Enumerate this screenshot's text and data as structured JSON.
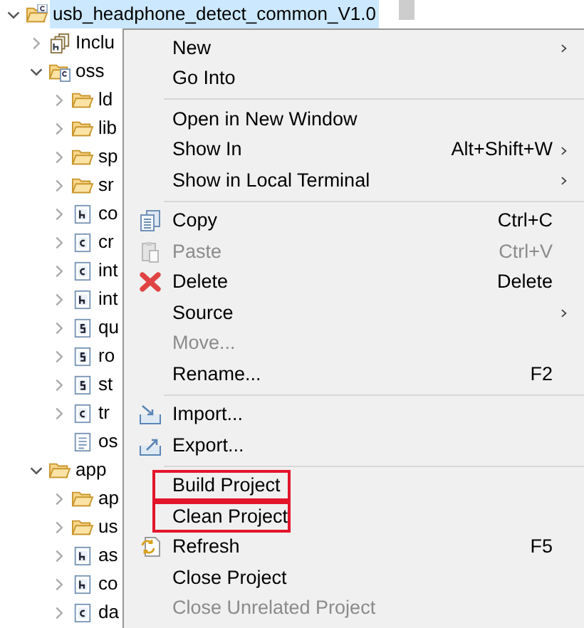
{
  "tree": [
    {
      "label": "usb_headphone_detect_common_V1.0",
      "kind": "project",
      "expanded": true,
      "selected": true,
      "children": [
        {
          "label": "Inclu",
          "kind": "includes",
          "expanded": false,
          "selected": false
        },
        {
          "label": "oss",
          "kind": "source-folder",
          "expanded": true,
          "selected": false,
          "children": [
            {
              "label": "ld",
              "kind": "folder",
              "expanded": false,
              "selected": false
            },
            {
              "label": "lib",
              "kind": "folder",
              "expanded": false,
              "selected": false
            },
            {
              "label": "sp",
              "kind": "folder",
              "expanded": false,
              "selected": false
            },
            {
              "label": "sr",
              "kind": "folder",
              "expanded": false,
              "selected": false
            },
            {
              "label": "co",
              "kind": "h",
              "expanded": false,
              "selected": false
            },
            {
              "label": "cr",
              "kind": "c",
              "expanded": false,
              "selected": false
            },
            {
              "label": "int",
              "kind": "c",
              "expanded": false,
              "selected": false
            },
            {
              "label": "int",
              "kind": "h",
              "expanded": false,
              "selected": false
            },
            {
              "label": "qu",
              "kind": "s",
              "expanded": false,
              "selected": false
            },
            {
              "label": "ro",
              "kind": "s",
              "expanded": false,
              "selected": false
            },
            {
              "label": "st",
              "kind": "s",
              "expanded": false,
              "selected": false
            },
            {
              "label": "tr",
              "kind": "c",
              "expanded": false,
              "selected": false
            },
            {
              "label": "os",
              "kind": "text",
              "selected": false
            }
          ]
        },
        {
          "label": "app",
          "kind": "folder",
          "expanded": true,
          "selected": false,
          "children": [
            {
              "label": "ap",
              "kind": "folder",
              "expanded": false,
              "selected": false
            },
            {
              "label": "us",
              "kind": "folder",
              "expanded": false,
              "selected": false
            },
            {
              "label": "as",
              "kind": "h",
              "expanded": false,
              "selected": false
            },
            {
              "label": "co",
              "kind": "h",
              "expanded": false,
              "selected": false
            },
            {
              "label": "da",
              "kind": "c",
              "expanded": false,
              "selected": false
            }
          ]
        }
      ]
    }
  ],
  "context_menu": [
    {
      "kind": "item",
      "label": "New",
      "submenu": true,
      "disabled": false,
      "highlighted": false
    },
    {
      "kind": "item",
      "label": "Go Into",
      "disabled": false,
      "highlighted": false
    },
    {
      "kind": "separator"
    },
    {
      "kind": "item",
      "label": "Open in New Window",
      "disabled": false,
      "highlighted": false
    },
    {
      "kind": "item",
      "label": "Show In",
      "shortcut": "Alt+Shift+W",
      "submenu": true,
      "disabled": false,
      "highlighted": false
    },
    {
      "kind": "item",
      "label": "Show in Local Terminal",
      "submenu": true,
      "disabled": false,
      "highlighted": false
    },
    {
      "kind": "separator"
    },
    {
      "kind": "copy",
      "label": "Copy",
      "shortcut": "Ctrl+C",
      "disabled": false,
      "highlighted": false
    },
    {
      "kind": "paste",
      "label": "Paste",
      "shortcut": "Ctrl+V",
      "disabled": true,
      "highlighted": false
    },
    {
      "kind": "delete",
      "label": "Delete",
      "shortcut": "Delete",
      "disabled": false,
      "highlighted": false
    },
    {
      "kind": "item",
      "label": "Source",
      "submenu": true,
      "disabled": false,
      "highlighted": false
    },
    {
      "kind": "item",
      "label": "Move...",
      "disabled": true,
      "highlighted": false
    },
    {
      "kind": "item",
      "label": "Rename...",
      "shortcut": "F2",
      "disabled": false,
      "highlighted": false
    },
    {
      "kind": "separator"
    },
    {
      "kind": "import",
      "label": "Import...",
      "disabled": false,
      "highlighted": false
    },
    {
      "kind": "export",
      "label": "Export...",
      "disabled": false,
      "highlighted": false
    },
    {
      "kind": "separator"
    },
    {
      "kind": "item",
      "label": "Build Project",
      "disabled": false,
      "highlighted": true
    },
    {
      "kind": "item",
      "label": "Clean Project",
      "disabled": false,
      "highlighted": true
    },
    {
      "kind": "refresh",
      "label": "Refresh",
      "shortcut": "F5",
      "disabled": false,
      "highlighted": false
    },
    {
      "kind": "item",
      "label": "Close Project",
      "disabled": false,
      "highlighted": false
    },
    {
      "kind": "item",
      "label": "Close Unrelated Project",
      "disabled": true,
      "highlighted": false
    }
  ]
}
